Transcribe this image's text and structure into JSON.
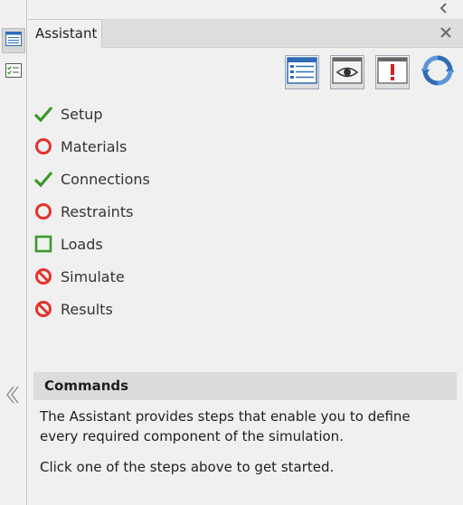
{
  "panel": {
    "tab_label": "Assistant"
  },
  "toolbar": {
    "buttons": [
      "list-view-icon",
      "eye-icon",
      "warning-icon",
      "refresh-icon"
    ]
  },
  "steps": [
    {
      "label": "Setup",
      "status": "complete"
    },
    {
      "label": "Materials",
      "status": "required"
    },
    {
      "label": "Connections",
      "status": "complete"
    },
    {
      "label": "Restraints",
      "status": "required"
    },
    {
      "label": "Loads",
      "status": "optional"
    },
    {
      "label": "Simulate",
      "status": "blocked"
    },
    {
      "label": "Results",
      "status": "blocked"
    }
  ],
  "commands": {
    "title": "Commands",
    "paragraph1": "The Assistant provides steps that enable you to define every required component of the simulation.",
    "paragraph2": "Click one of the steps above to get started."
  },
  "colors": {
    "check": "#3a9a28",
    "ring": "#e4322b",
    "square": "#3a9a28",
    "blocked": "#e4322b"
  }
}
